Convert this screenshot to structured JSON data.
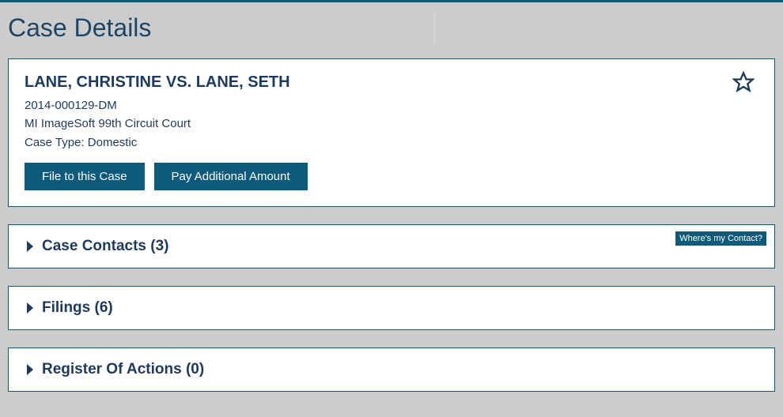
{
  "page": {
    "title": "Case Details"
  },
  "caseCard": {
    "title": "LANE, CHRISTINE VS. LANE, SETH",
    "caseNumber": "2014-000129-DM",
    "court": "MI ImageSoft 99th Circuit Court",
    "caseType": "Case Type: Domestic",
    "buttons": {
      "fileToCase": "File to this Case",
      "payAdditional": "Pay Additional Amount"
    }
  },
  "sections": {
    "contacts": {
      "label": "Case Contacts (3)",
      "helpLink": "Where's my Contact?"
    },
    "filings": {
      "label": "Filings (6)"
    },
    "registerOfActions": {
      "label": "Register Of Actions (0)"
    }
  }
}
